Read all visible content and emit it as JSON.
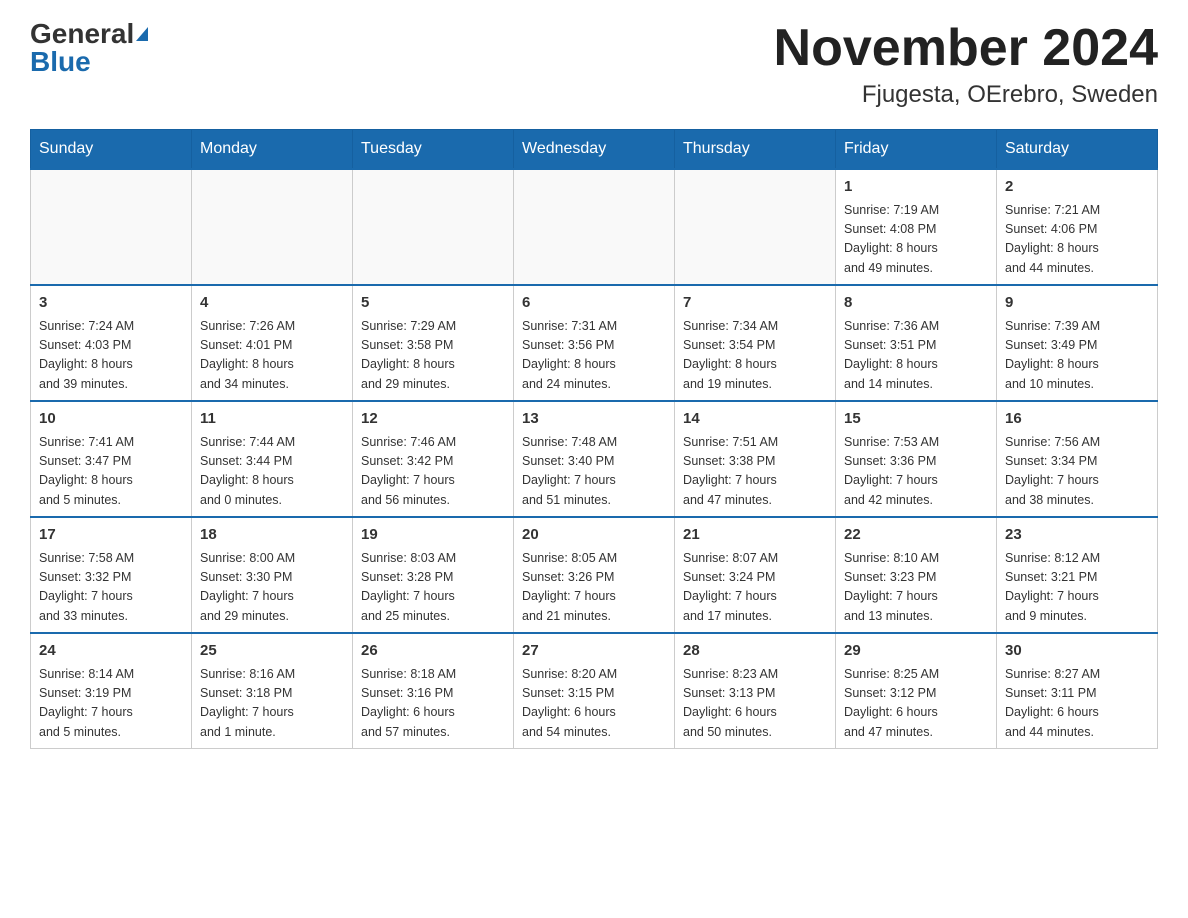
{
  "logo": {
    "general": "General",
    "blue": "Blue"
  },
  "title": {
    "month_year": "November 2024",
    "location": "Fjugesta, OErebro, Sweden"
  },
  "days_of_week": [
    "Sunday",
    "Monday",
    "Tuesday",
    "Wednesday",
    "Thursday",
    "Friday",
    "Saturday"
  ],
  "weeks": [
    [
      {
        "day": "",
        "info": ""
      },
      {
        "day": "",
        "info": ""
      },
      {
        "day": "",
        "info": ""
      },
      {
        "day": "",
        "info": ""
      },
      {
        "day": "",
        "info": ""
      },
      {
        "day": "1",
        "info": "Sunrise: 7:19 AM\nSunset: 4:08 PM\nDaylight: 8 hours\nand 49 minutes."
      },
      {
        "day": "2",
        "info": "Sunrise: 7:21 AM\nSunset: 4:06 PM\nDaylight: 8 hours\nand 44 minutes."
      }
    ],
    [
      {
        "day": "3",
        "info": "Sunrise: 7:24 AM\nSunset: 4:03 PM\nDaylight: 8 hours\nand 39 minutes."
      },
      {
        "day": "4",
        "info": "Sunrise: 7:26 AM\nSunset: 4:01 PM\nDaylight: 8 hours\nand 34 minutes."
      },
      {
        "day": "5",
        "info": "Sunrise: 7:29 AM\nSunset: 3:58 PM\nDaylight: 8 hours\nand 29 minutes."
      },
      {
        "day": "6",
        "info": "Sunrise: 7:31 AM\nSunset: 3:56 PM\nDaylight: 8 hours\nand 24 minutes."
      },
      {
        "day": "7",
        "info": "Sunrise: 7:34 AM\nSunset: 3:54 PM\nDaylight: 8 hours\nand 19 minutes."
      },
      {
        "day": "8",
        "info": "Sunrise: 7:36 AM\nSunset: 3:51 PM\nDaylight: 8 hours\nand 14 minutes."
      },
      {
        "day": "9",
        "info": "Sunrise: 7:39 AM\nSunset: 3:49 PM\nDaylight: 8 hours\nand 10 minutes."
      }
    ],
    [
      {
        "day": "10",
        "info": "Sunrise: 7:41 AM\nSunset: 3:47 PM\nDaylight: 8 hours\nand 5 minutes."
      },
      {
        "day": "11",
        "info": "Sunrise: 7:44 AM\nSunset: 3:44 PM\nDaylight: 8 hours\nand 0 minutes."
      },
      {
        "day": "12",
        "info": "Sunrise: 7:46 AM\nSunset: 3:42 PM\nDaylight: 7 hours\nand 56 minutes."
      },
      {
        "day": "13",
        "info": "Sunrise: 7:48 AM\nSunset: 3:40 PM\nDaylight: 7 hours\nand 51 minutes."
      },
      {
        "day": "14",
        "info": "Sunrise: 7:51 AM\nSunset: 3:38 PM\nDaylight: 7 hours\nand 47 minutes."
      },
      {
        "day": "15",
        "info": "Sunrise: 7:53 AM\nSunset: 3:36 PM\nDaylight: 7 hours\nand 42 minutes."
      },
      {
        "day": "16",
        "info": "Sunrise: 7:56 AM\nSunset: 3:34 PM\nDaylight: 7 hours\nand 38 minutes."
      }
    ],
    [
      {
        "day": "17",
        "info": "Sunrise: 7:58 AM\nSunset: 3:32 PM\nDaylight: 7 hours\nand 33 minutes."
      },
      {
        "day": "18",
        "info": "Sunrise: 8:00 AM\nSunset: 3:30 PM\nDaylight: 7 hours\nand 29 minutes."
      },
      {
        "day": "19",
        "info": "Sunrise: 8:03 AM\nSunset: 3:28 PM\nDaylight: 7 hours\nand 25 minutes."
      },
      {
        "day": "20",
        "info": "Sunrise: 8:05 AM\nSunset: 3:26 PM\nDaylight: 7 hours\nand 21 minutes."
      },
      {
        "day": "21",
        "info": "Sunrise: 8:07 AM\nSunset: 3:24 PM\nDaylight: 7 hours\nand 17 minutes."
      },
      {
        "day": "22",
        "info": "Sunrise: 8:10 AM\nSunset: 3:23 PM\nDaylight: 7 hours\nand 13 minutes."
      },
      {
        "day": "23",
        "info": "Sunrise: 8:12 AM\nSunset: 3:21 PM\nDaylight: 7 hours\nand 9 minutes."
      }
    ],
    [
      {
        "day": "24",
        "info": "Sunrise: 8:14 AM\nSunset: 3:19 PM\nDaylight: 7 hours\nand 5 minutes."
      },
      {
        "day": "25",
        "info": "Sunrise: 8:16 AM\nSunset: 3:18 PM\nDaylight: 7 hours\nand 1 minute."
      },
      {
        "day": "26",
        "info": "Sunrise: 8:18 AM\nSunset: 3:16 PM\nDaylight: 6 hours\nand 57 minutes."
      },
      {
        "day": "27",
        "info": "Sunrise: 8:20 AM\nSunset: 3:15 PM\nDaylight: 6 hours\nand 54 minutes."
      },
      {
        "day": "28",
        "info": "Sunrise: 8:23 AM\nSunset: 3:13 PM\nDaylight: 6 hours\nand 50 minutes."
      },
      {
        "day": "29",
        "info": "Sunrise: 8:25 AM\nSunset: 3:12 PM\nDaylight: 6 hours\nand 47 minutes."
      },
      {
        "day": "30",
        "info": "Sunrise: 8:27 AM\nSunset: 3:11 PM\nDaylight: 6 hours\nand 44 minutes."
      }
    ]
  ]
}
